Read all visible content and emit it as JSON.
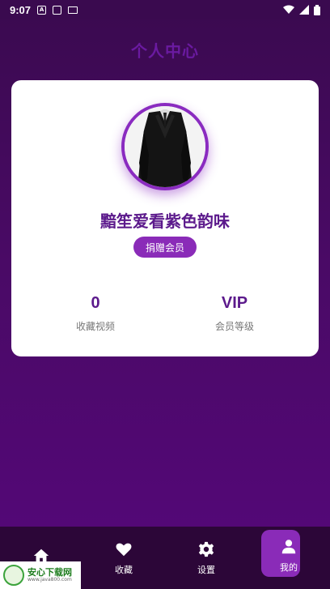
{
  "status_bar": {
    "time": "9:07",
    "notif_a": "A"
  },
  "header": {
    "title": "个人中心"
  },
  "profile": {
    "username": "黯笙爱看紫色韵味",
    "donate_label": "捐赠会员",
    "stats": [
      {
        "value": "0",
        "label": "收藏视频"
      },
      {
        "value": "VIP",
        "label": "会员等级"
      }
    ]
  },
  "bottom_nav": {
    "items": [
      {
        "label": "",
        "icon": "home-icon"
      },
      {
        "label": "收藏",
        "icon": "heart-icon"
      },
      {
        "label": "设置",
        "icon": "gear-icon"
      },
      {
        "label": "我的",
        "icon": "person-icon",
        "active": true
      }
    ]
  },
  "watermark": {
    "title": "安心下载网",
    "url": "www.java800.com"
  },
  "colors": {
    "accent": "#8a2bb8",
    "title": "#5c1a8c",
    "background": "#4a0a66"
  }
}
